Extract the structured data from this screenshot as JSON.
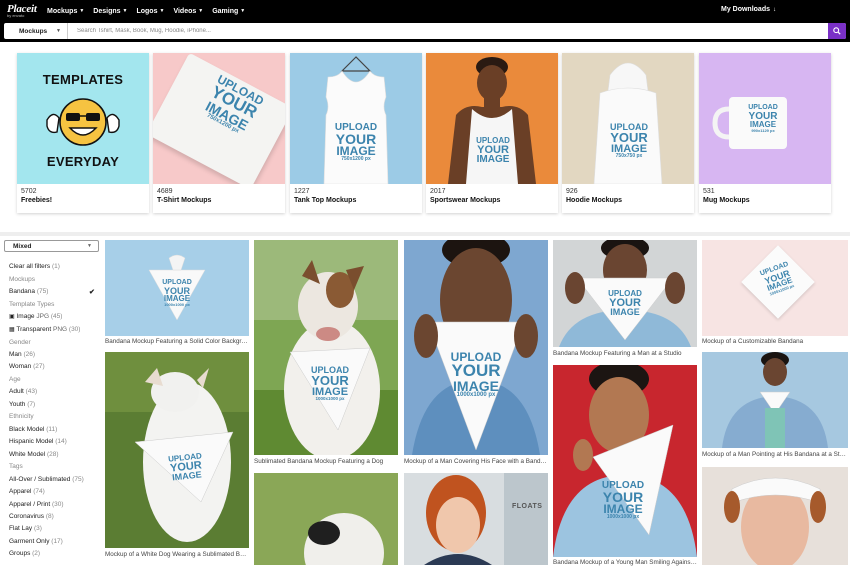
{
  "nav": {
    "logo": "Placeit",
    "logo_sub": "by envato",
    "items": [
      "Mockups",
      "Designs",
      "Logos",
      "Videos",
      "Gaming"
    ],
    "my_downloads": "My Downloads"
  },
  "search": {
    "category": "Mockups",
    "placeholder": "Search Tshirt, Mask, Book, Mug, Hoodie, iPhone..."
  },
  "categories": [
    {
      "count": "5702",
      "name": "Freebies!",
      "overlay_top": "TEMPLATES",
      "overlay_bottom": "EVERYDAY"
    },
    {
      "count": "4689",
      "name": "T-Shirt Mockups"
    },
    {
      "count": "1227",
      "name": "Tank Top Mockups"
    },
    {
      "count": "2017",
      "name": "Sportswear Mockups"
    },
    {
      "count": "926",
      "name": "Hoodie Mockups"
    },
    {
      "count": "531",
      "name": "Mug Mockups"
    }
  ],
  "upload_text": {
    "line1": "UPLOAD",
    "line2": "YOUR",
    "line3": "IMAGE",
    "size_750": "750x750 px",
    "size_750x1200": "750x1200 px",
    "size_1000": "1000x1000 px",
    "size_mug": "990x1129 px"
  },
  "sidebar": {
    "sort": "Mixed",
    "clear": {
      "label": "Clear all filters",
      "count": "(1)"
    },
    "mockups_head": "Mockups",
    "bandana": {
      "label": "Bandana",
      "count": "(75)"
    },
    "template_types_head": "Template Types",
    "image": {
      "label": "Image",
      "ft": "JPG",
      "count": "(45)"
    },
    "transparent": {
      "label": "Transparent",
      "ft": "PNG",
      "count": "(30)"
    },
    "gender_head": "Gender",
    "man": {
      "label": "Man",
      "count": "(26)"
    },
    "woman": {
      "label": "Woman",
      "count": "(27)"
    },
    "age_head": "Age",
    "adult": {
      "label": "Adult",
      "count": "(43)"
    },
    "youth": {
      "label": "Youth",
      "count": "(7)"
    },
    "ethnicity_head": "Ethnicity",
    "black": {
      "label": "Black Model",
      "count": "(11)"
    },
    "hispanic": {
      "label": "Hispanic Model",
      "count": "(14)"
    },
    "white": {
      "label": "White Model",
      "count": "(28)"
    },
    "tags_head": "Tags",
    "t1": {
      "label": "All-Over / Sublimated",
      "count": "(75)"
    },
    "t2": {
      "label": "Apparel",
      "count": "(74)"
    },
    "t3": {
      "label": "Apparel / Print",
      "count": "(30)"
    },
    "t4": {
      "label": "Coronavirus",
      "count": "(8)"
    },
    "t5": {
      "label": "Flat Lay",
      "count": "(3)"
    },
    "t6": {
      "label": "Garment Only",
      "count": "(17)"
    },
    "t7": {
      "label": "Groups",
      "count": "(2)"
    }
  },
  "captions": {
    "c1": "Bandana Mockup Featuring a Solid Color Background",
    "c2": "Mockup of a White Dog Wearing a Sublimated Bandana",
    "c3": "Sublimated Bandana Mockup Featuring a Dog",
    "c4": "Mockup of a Man Covering His Face with a Bandana",
    "c5": "Bandana Mockup Featuring a Man at a Studio",
    "c6": "Bandana Mockup of a Young Man Smiling Against a Red Wall",
    "c7": "Mockup of a Customizable Bandana",
    "c8": "Mockup of a Man Pointing at His Bandana at a Studio"
  },
  "photo_text": {
    "sign": "FLOATS"
  },
  "colors": {
    "accent": "#7a30c6",
    "nav_bg": "#000000"
  }
}
